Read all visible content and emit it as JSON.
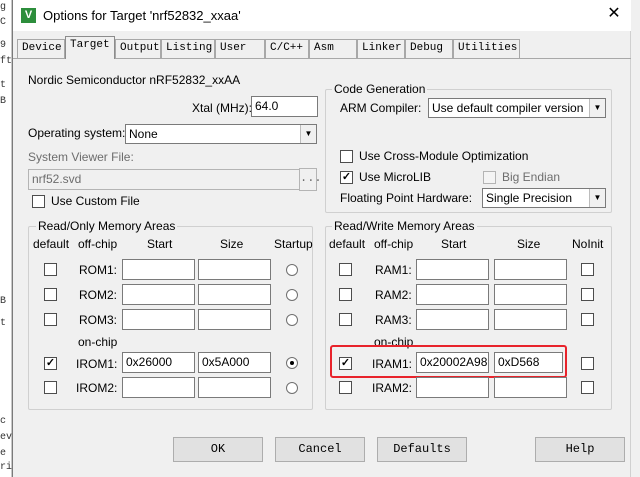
{
  "background": {
    "left_chars": [
      "g",
      "C",
      "9",
      "ft",
      "t",
      "B",
      "",
      "",
      "B",
      "t",
      "",
      "",
      "c",
      "ev",
      "e",
      "ri"
    ]
  },
  "dialog": {
    "title": "Options for Target 'nrf52832_xxaa'",
    "icon_label": "V",
    "close_label": "✕"
  },
  "tabs": [
    {
      "label": "Device"
    },
    {
      "label": "Target"
    },
    {
      "label": "Output"
    },
    {
      "label": "Listing"
    },
    {
      "label": "User"
    },
    {
      "label": "C/C++"
    },
    {
      "label": "Asm"
    },
    {
      "label": "Linker"
    },
    {
      "label": "Debug"
    },
    {
      "label": "Utilities"
    }
  ],
  "target": {
    "device_name": "Nordic Semiconductor nRF52832_xxAA",
    "xtal_label": "Xtal (MHz):",
    "xtal_value": "64.0",
    "os_label": "Operating system:",
    "os_value": "None",
    "svf_label": "System Viewer File:",
    "svf_value": "nrf52.svd",
    "browse_label": "...",
    "custom_file_label": "Use Custom File"
  },
  "codegen": {
    "title": "Code Generation",
    "compiler_label": "ARM Compiler:",
    "compiler_value": "Use default compiler version",
    "cross_module_label": "Use Cross-Module Optimization",
    "microlib_label": "Use MicroLIB",
    "big_endian_label": "Big Endian",
    "fpu_label": "Floating Point Hardware:",
    "fpu_value": "Single Precision"
  },
  "rom": {
    "title": "Read/Only Memory Areas",
    "headers": {
      "default": "default",
      "offchip": "off-chip",
      "start": "Start",
      "size": "Size",
      "startup": "Startup"
    },
    "onchip_label": "on-chip",
    "rows": [
      {
        "name": "ROM1:",
        "start": "",
        "size": ""
      },
      {
        "name": "ROM2:",
        "start": "",
        "size": ""
      },
      {
        "name": "ROM3:",
        "start": "",
        "size": ""
      },
      {
        "name": "IROM1:",
        "start": "0x26000",
        "size": "0x5A000"
      },
      {
        "name": "IROM2:",
        "start": "",
        "size": ""
      }
    ]
  },
  "ram": {
    "title": "Read/Write Memory Areas",
    "headers": {
      "default": "default",
      "offchip": "off-chip",
      "start": "Start",
      "size": "Size",
      "noinit": "NoInit"
    },
    "onchip_label": "on-chip",
    "rows": [
      {
        "name": "RAM1:",
        "start": "",
        "size": ""
      },
      {
        "name": "RAM2:",
        "start": "",
        "size": ""
      },
      {
        "name": "RAM3:",
        "start": "",
        "size": ""
      },
      {
        "name": "IRAM1:",
        "start": "0x20002A98",
        "size": "0xD568"
      },
      {
        "name": "IRAM2:",
        "start": "",
        "size": ""
      }
    ]
  },
  "buttons": {
    "ok": "OK",
    "cancel": "Cancel",
    "defaults": "Defaults",
    "help": "Help"
  },
  "colors": {
    "highlight": "#e8232b",
    "dialog_bg": "#f0f0f0"
  }
}
